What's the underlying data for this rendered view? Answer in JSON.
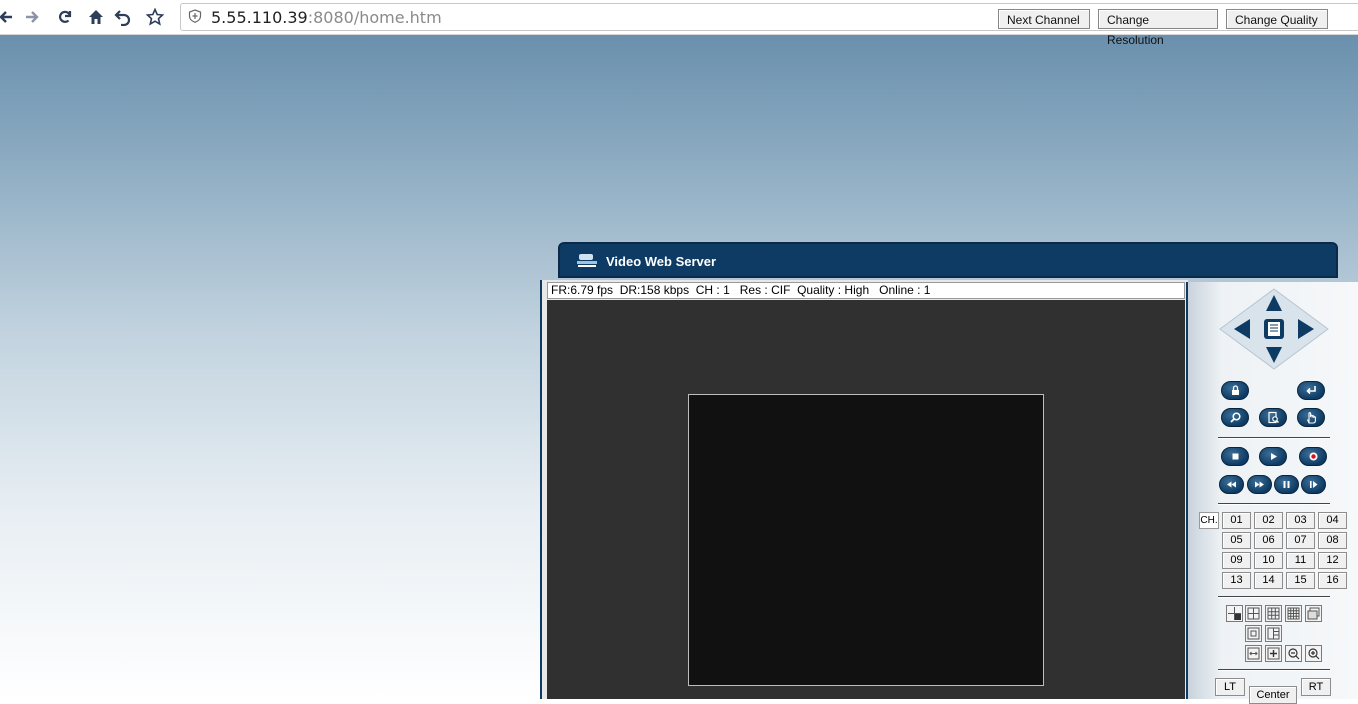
{
  "browser": {
    "url_host": "5.55.110.39",
    "url_rest": ":8080/home.htm"
  },
  "header": {
    "title": "Video Web Server",
    "buttons": [
      "Next Channel",
      "Change Resolution",
      "Change Quality"
    ]
  },
  "status": {
    "text": "FR:6.79 fps  DR:158 kbps  CH : 1   Res : CIF  Quality : High   Online : 1"
  },
  "panel": {
    "ch_label": "CH.",
    "channels": [
      "01",
      "02",
      "03",
      "04",
      "05",
      "06",
      "07",
      "08",
      "09",
      "10",
      "11",
      "12",
      "13",
      "14",
      "15",
      "16"
    ],
    "ptz": {
      "lt": "LT",
      "center": "Center",
      "rt": "RT"
    }
  },
  "colors": {
    "frame": "#0d3b63",
    "video_bg": "#303030"
  }
}
